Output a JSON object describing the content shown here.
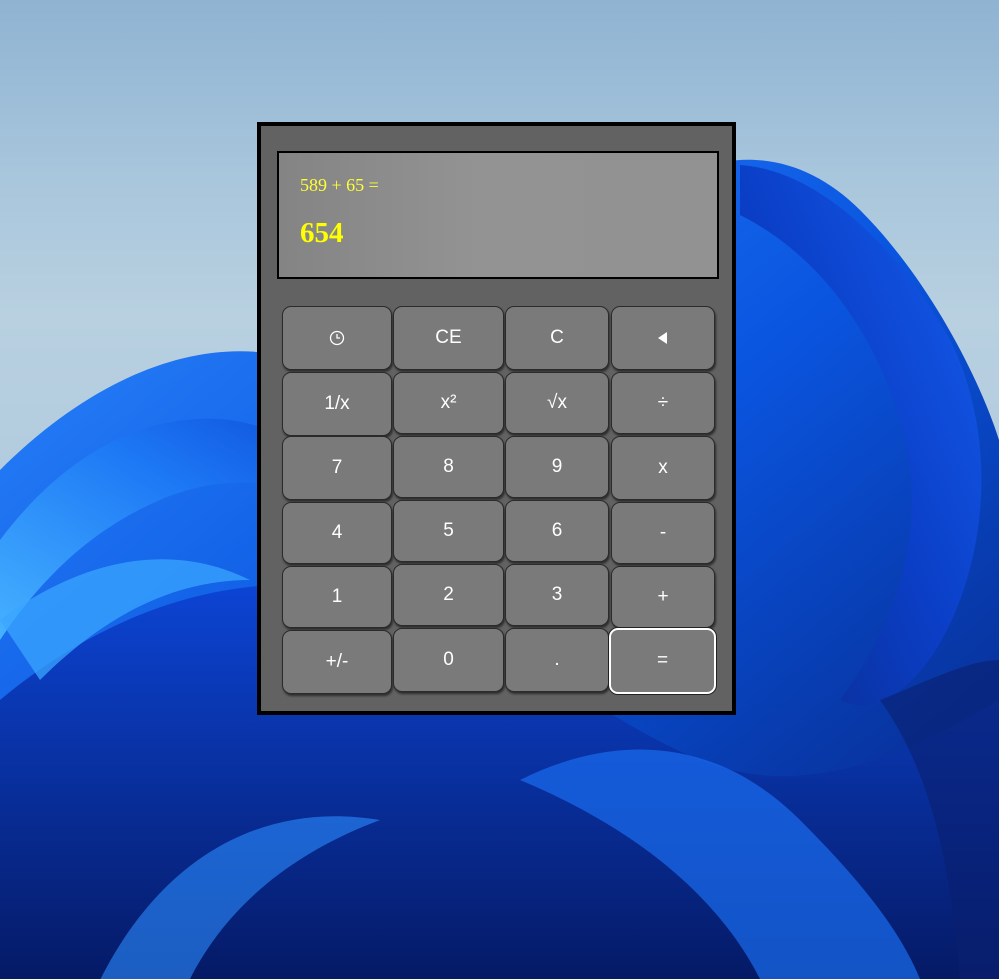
{
  "calculator": {
    "display": {
      "expression": "589 + 65 =",
      "result": "654"
    },
    "keys": [
      {
        "name": "history-button",
        "label": "",
        "icon": "history-clock-icon"
      },
      {
        "name": "clear-entry-button",
        "label": "CE"
      },
      {
        "name": "clear-button",
        "label": "C"
      },
      {
        "name": "backspace-button",
        "label": "",
        "icon": "backspace-triangle-icon"
      },
      {
        "name": "reciprocal-button",
        "label": "1/x"
      },
      {
        "name": "square-button",
        "label": "x²"
      },
      {
        "name": "square-root-button",
        "label": "√x"
      },
      {
        "name": "divide-button",
        "label": "÷"
      },
      {
        "name": "digit-7-button",
        "label": "7"
      },
      {
        "name": "digit-8-button",
        "label": "8"
      },
      {
        "name": "digit-9-button",
        "label": "9"
      },
      {
        "name": "multiply-button",
        "label": "x"
      },
      {
        "name": "digit-4-button",
        "label": "4"
      },
      {
        "name": "digit-5-button",
        "label": "5"
      },
      {
        "name": "digit-6-button",
        "label": "6"
      },
      {
        "name": "subtract-button",
        "label": "-"
      },
      {
        "name": "digit-1-button",
        "label": "1"
      },
      {
        "name": "digit-2-button",
        "label": "2"
      },
      {
        "name": "digit-3-button",
        "label": "3"
      },
      {
        "name": "add-button",
        "label": "+"
      },
      {
        "name": "negate-button",
        "label": "+/-"
      },
      {
        "name": "digit-0-button",
        "label": "0"
      },
      {
        "name": "decimal-button",
        "label": "."
      },
      {
        "name": "equals-button",
        "label": "="
      }
    ]
  }
}
